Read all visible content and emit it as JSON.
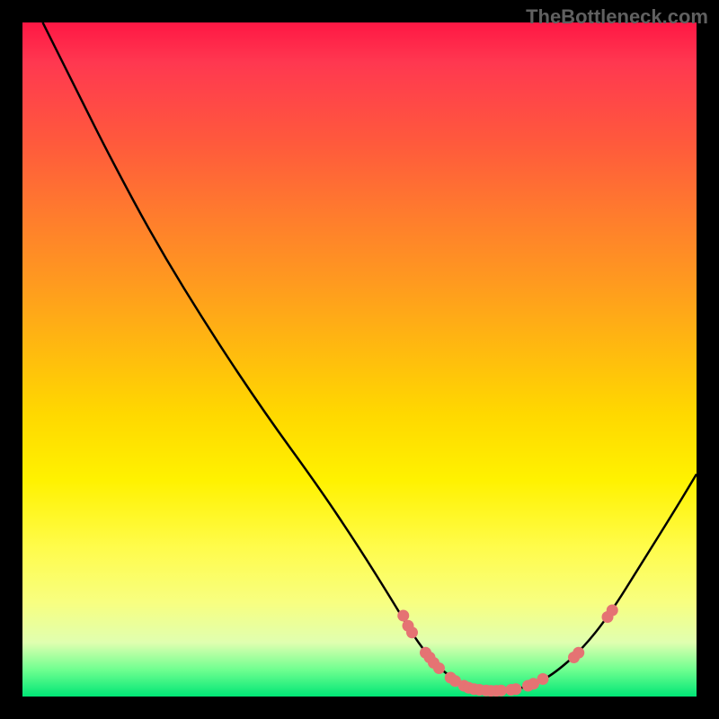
{
  "watermark": "TheBottleneck.com",
  "chart_data": {
    "type": "line",
    "title": "",
    "xlabel": "",
    "ylabel": "",
    "xlim": [
      0,
      100
    ],
    "ylim": [
      0,
      100
    ],
    "curve": {
      "name": "bottleneck-curve",
      "points": [
        {
          "x": 3.0,
          "y": 100.0
        },
        {
          "x": 8.0,
          "y": 90.0
        },
        {
          "x": 13.0,
          "y": 80.0
        },
        {
          "x": 20.0,
          "y": 67.0
        },
        {
          "x": 28.0,
          "y": 54.0
        },
        {
          "x": 36.0,
          "y": 42.0
        },
        {
          "x": 44.0,
          "y": 31.0
        },
        {
          "x": 50.0,
          "y": 22.0
        },
        {
          "x": 55.0,
          "y": 14.0
        },
        {
          "x": 58.0,
          "y": 9.0
        },
        {
          "x": 61.0,
          "y": 5.0
        },
        {
          "x": 64.0,
          "y": 2.5
        },
        {
          "x": 67.0,
          "y": 1.2
        },
        {
          "x": 70.0,
          "y": 0.8
        },
        {
          "x": 73.0,
          "y": 1.0
        },
        {
          "x": 76.0,
          "y": 1.8
        },
        {
          "x": 79.0,
          "y": 3.5
        },
        {
          "x": 83.0,
          "y": 7.0
        },
        {
          "x": 87.0,
          "y": 12.0
        },
        {
          "x": 92.0,
          "y": 20.0
        },
        {
          "x": 97.0,
          "y": 28.0
        },
        {
          "x": 100.0,
          "y": 33.0
        }
      ]
    },
    "markers": {
      "name": "data-points",
      "color": "#e57373",
      "points": [
        {
          "x": 56.5,
          "y": 12.0
        },
        {
          "x": 57.2,
          "y": 10.5
        },
        {
          "x": 57.8,
          "y": 9.5
        },
        {
          "x": 59.8,
          "y": 6.5
        },
        {
          "x": 60.4,
          "y": 5.8
        },
        {
          "x": 61.0,
          "y": 5.0
        },
        {
          "x": 61.8,
          "y": 4.2
        },
        {
          "x": 63.5,
          "y": 2.8
        },
        {
          "x": 64.2,
          "y": 2.3
        },
        {
          "x": 65.5,
          "y": 1.6
        },
        {
          "x": 66.2,
          "y": 1.3
        },
        {
          "x": 67.0,
          "y": 1.1
        },
        {
          "x": 67.8,
          "y": 1.0
        },
        {
          "x": 68.8,
          "y": 0.9
        },
        {
          "x": 69.5,
          "y": 0.85
        },
        {
          "x": 70.3,
          "y": 0.85
        },
        {
          "x": 71.0,
          "y": 0.9
        },
        {
          "x": 72.5,
          "y": 1.0
        },
        {
          "x": 73.2,
          "y": 1.1
        },
        {
          "x": 75.0,
          "y": 1.6
        },
        {
          "x": 75.8,
          "y": 1.9
        },
        {
          "x": 77.2,
          "y": 2.6
        },
        {
          "x": 81.8,
          "y": 5.8
        },
        {
          "x": 82.5,
          "y": 6.5
        },
        {
          "x": 86.8,
          "y": 11.8
        },
        {
          "x": 87.5,
          "y": 12.8
        }
      ]
    }
  }
}
